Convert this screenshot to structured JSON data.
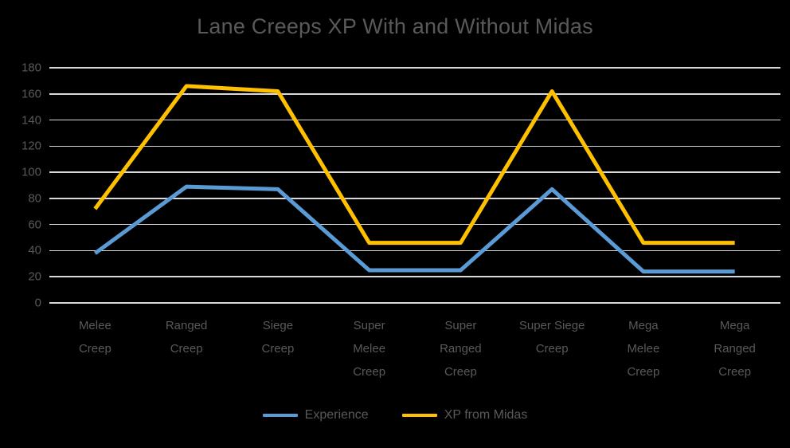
{
  "chart_data": {
    "type": "line",
    "title": "Lane Creeps XP With and Without Midas",
    "xlabel": "",
    "ylabel": "",
    "ylim": [
      0,
      180
    ],
    "ytick_step": 20,
    "grid": true,
    "legend_position": "bottom",
    "categories": [
      "Melee Creep",
      "Ranged Creep",
      "Siege Creep",
      "Super Melee Creep",
      "Super Ranged Creep",
      "Super Siege Creep",
      "Mega Melee Creep",
      "Mega Ranged Creep"
    ],
    "category_lines": [
      [
        "Melee",
        "Creep"
      ],
      [
        "Ranged",
        "Creep"
      ],
      [
        "Siege",
        "Creep"
      ],
      [
        "Super",
        "Melee",
        "Creep"
      ],
      [
        "Super",
        "Ranged",
        "Creep"
      ],
      [
        "Super Siege",
        "Creep"
      ],
      [
        "Mega",
        "Melee",
        "Creep"
      ],
      [
        "Mega",
        "Ranged",
        "Creep"
      ]
    ],
    "ytick_labels": [
      "180",
      "160",
      "140",
      "120",
      "100",
      "80",
      "60",
      "40",
      "20",
      "0"
    ],
    "ytick_values": [
      180,
      160,
      140,
      120,
      100,
      80,
      60,
      40,
      20,
      0
    ],
    "series": [
      {
        "name": "Experience",
        "color": "#5B9BD5",
        "values": [
          38,
          89,
          87,
          25,
          25,
          87,
          24,
          24
        ]
      },
      {
        "name": "XP from Midas",
        "color": "#FFC000",
        "values": [
          72,
          166,
          162,
          46,
          46,
          162,
          46,
          46
        ]
      }
    ]
  },
  "legend": {
    "entries": [
      {
        "label": "Experience",
        "color": "#5B9BD5"
      },
      {
        "label": "XP from Midas",
        "color": "#FFC000"
      }
    ]
  },
  "colors": {
    "background": "#000000",
    "text": "#595959",
    "gridline": "#d9d9d9",
    "series_experience": "#5B9BD5",
    "series_midas": "#FFC000"
  }
}
